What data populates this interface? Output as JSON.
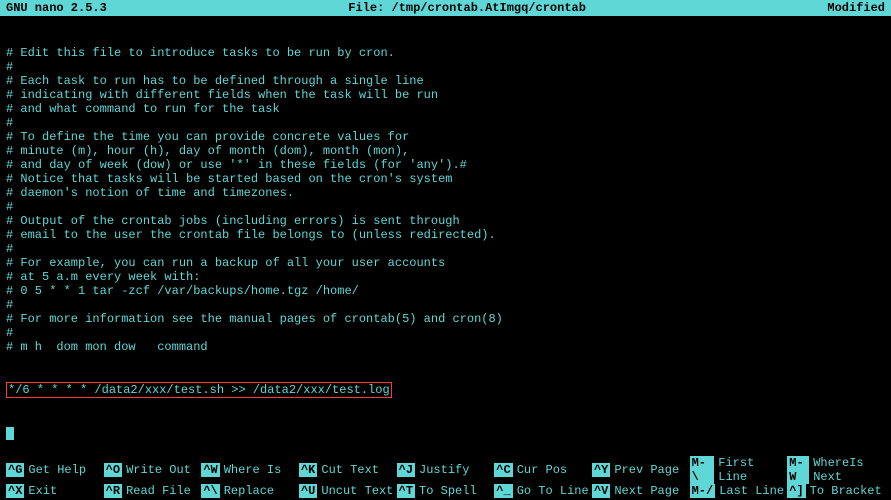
{
  "header": {
    "app": "  GNU nano 2.5.3",
    "file_label": "File: /tmp/crontab.AtImgq/crontab",
    "status": "Modified"
  },
  "file_lines": [
    "# Edit this file to introduce tasks to be run by cron.",
    "#",
    "# Each task to run has to be defined through a single line",
    "# indicating with different fields when the task will be run",
    "# and what command to run for the task",
    "#",
    "# To define the time you can provide concrete values for",
    "# minute (m), hour (h), day of month (dom), month (mon),",
    "# and day of week (dow) or use '*' in these fields (for 'any').#",
    "# Notice that tasks will be started based on the cron's system",
    "# daemon's notion of time and timezones.",
    "#",
    "# Output of the crontab jobs (including errors) is sent through",
    "# email to the user the crontab file belongs to (unless redirected).",
    "#",
    "# For example, you can run a backup of all your user accounts",
    "# at 5 a.m every week with:",
    "# 0 5 * * 1 tar -zcf /var/backups/home.tgz /home/",
    "#",
    "# For more information see the manual pages of crontab(5) and cron(8)",
    "#",
    "# m h  dom mon dow   command"
  ],
  "highlighted_line": "*/6 * * * * /data2/xxx/test.sh >> /data2/xxx/test.log",
  "help": {
    "row1": [
      {
        "key": "^G",
        "label": "Get Help"
      },
      {
        "key": "^O",
        "label": "Write Out"
      },
      {
        "key": "^W",
        "label": "Where Is"
      },
      {
        "key": "^K",
        "label": "Cut Text"
      },
      {
        "key": "^J",
        "label": "Justify"
      },
      {
        "key": "^C",
        "label": "Cur Pos"
      },
      {
        "key": "^Y",
        "label": "Prev Page"
      }
    ],
    "row1b": [
      {
        "key": "M-\\",
        "label": "First Line"
      },
      {
        "key": "M-W",
        "label": "WhereIs Next"
      }
    ],
    "row2": [
      {
        "key": "^X",
        "label": "Exit"
      },
      {
        "key": "^R",
        "label": "Read File"
      },
      {
        "key": "^\\",
        "label": "Replace"
      },
      {
        "key": "^U",
        "label": "Uncut Text"
      },
      {
        "key": "^T",
        "label": "To Spell"
      },
      {
        "key": "^_",
        "label": "Go To Line"
      },
      {
        "key": "^V",
        "label": "Next Page"
      }
    ],
    "row2b": [
      {
        "key": "M-/",
        "label": "Last Line"
      },
      {
        "key": "^]",
        "label": "To Bracket"
      }
    ]
  },
  "watermark": ""
}
